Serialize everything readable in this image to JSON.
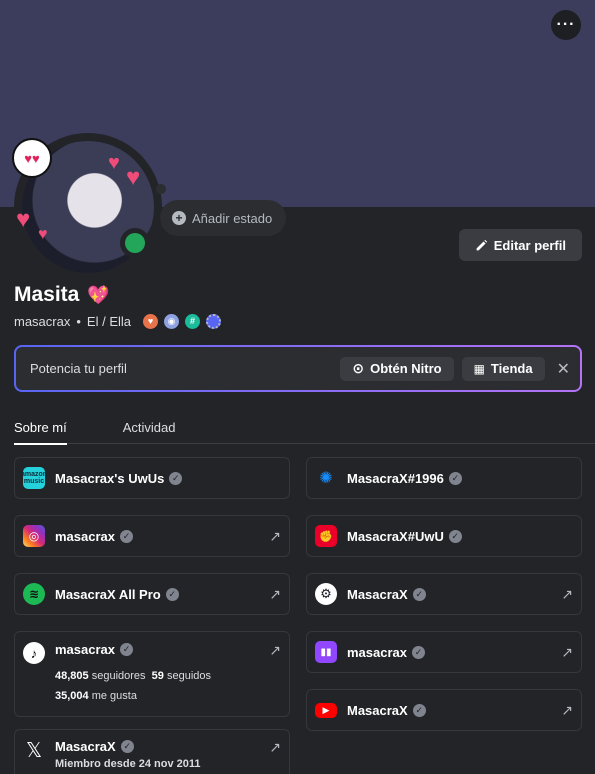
{
  "profile": {
    "display_name": "Masita",
    "username": "masacrax",
    "separator": "•",
    "pronouns": "El / Ella",
    "add_status": "Añadir estado",
    "edit_profile": "Editar perfil"
  },
  "nitro_bar": {
    "label": "Potencia tu perfil",
    "get_nitro": "Obtén Nitro",
    "shop": "Tienda"
  },
  "tabs": [
    "Sobre mí",
    "Actividad"
  ],
  "connections_left": [
    {
      "name": "Masacrax's UwUs",
      "icon": "amazon-music-icon",
      "color": "#25d1da",
      "link": false
    },
    {
      "name": "masacrax",
      "icon": "instagram-icon",
      "color": "#dd2a7b",
      "link": true
    },
    {
      "name": "MasacraX All Pro",
      "icon": "spotify-icon",
      "color": "#1db954",
      "link": true
    },
    {
      "name": "masacrax",
      "icon": "tiktok-icon",
      "color": "#ffffff",
      "link": true,
      "followers": "48,805",
      "followers_label": "seguidores",
      "following": "59",
      "following_label": "seguidos",
      "likes": "35,004",
      "likes_label": "me gusta"
    },
    {
      "name": "MasacraX",
      "icon": "x-icon",
      "color": "#ffffff",
      "link": true,
      "member_since": "Miembro desde 24 nov 2011"
    }
  ],
  "connections_right": [
    {
      "name": "MasacraX#1996",
      "icon": "battlenet-icon",
      "color": "#148eff",
      "link": false
    },
    {
      "name": "MasacraX#UwU",
      "icon": "riot-games-icon",
      "color": "#eb0029",
      "link": false
    },
    {
      "name": "MasacraX",
      "icon": "steam-icon",
      "color": "#ffffff",
      "link": true
    },
    {
      "name": "masacrax",
      "icon": "twitch-icon",
      "color": "#9146ff",
      "link": true
    },
    {
      "name": "MasacraX",
      "icon": "youtube-icon",
      "color": "#ff0000",
      "link": true
    }
  ]
}
